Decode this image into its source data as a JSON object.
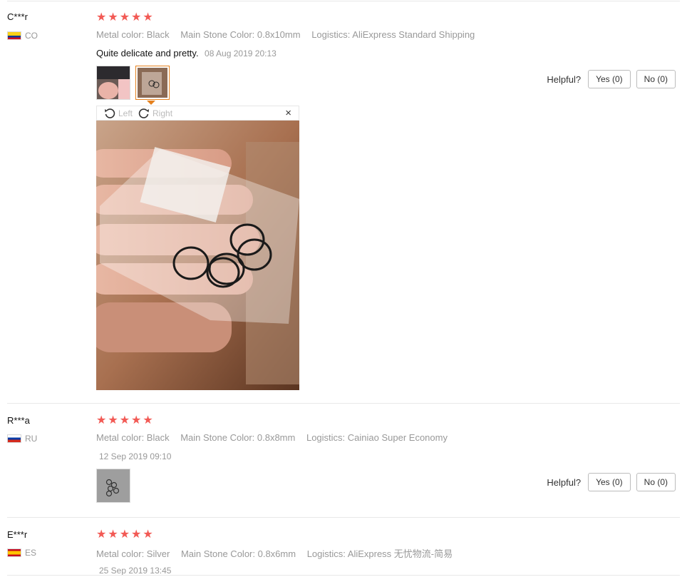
{
  "reviews": [
    {
      "user": "C***r",
      "country": "CO",
      "stars": "★★★★★",
      "attributes": [
        "Metal color: Black",
        "Main Stone Color: 0.8x10mm",
        "Logistics: AliExpress Standard Shipping"
      ],
      "feedback": "Quite delicate and pretty.",
      "date": "08 Aug 2019 20:13",
      "helpful_label": "Helpful?",
      "yes_label": "Yes (0)",
      "no_label": "No (0)"
    },
    {
      "user": "R***a",
      "country": "RU",
      "stars": "★★★★★",
      "attributes": [
        "Metal color: Black",
        "Main Stone Color: 0.8x8mm",
        "Logistics: Cainiao Super Economy"
      ],
      "feedback": "",
      "date": "12 Sep 2019 09:10",
      "helpful_label": "Helpful?",
      "yes_label": "Yes (0)",
      "no_label": "No (0)"
    },
    {
      "user": "E***r",
      "country": "ES",
      "stars": "★★★★★",
      "attributes": [
        "Metal color: Silver",
        "Main Stone Color: 0.8x6mm",
        "Logistics: AliExpress 无忧物流-简易"
      ],
      "feedback": "",
      "date": "25 Sep 2019 13:45"
    }
  ],
  "viewer": {
    "rotate_left": "Left",
    "rotate_right": "Right",
    "close_glyph": "×"
  },
  "colors": {
    "star": "#f25a55",
    "active_thumb": "#e5811e",
    "muted_text": "#999999"
  }
}
